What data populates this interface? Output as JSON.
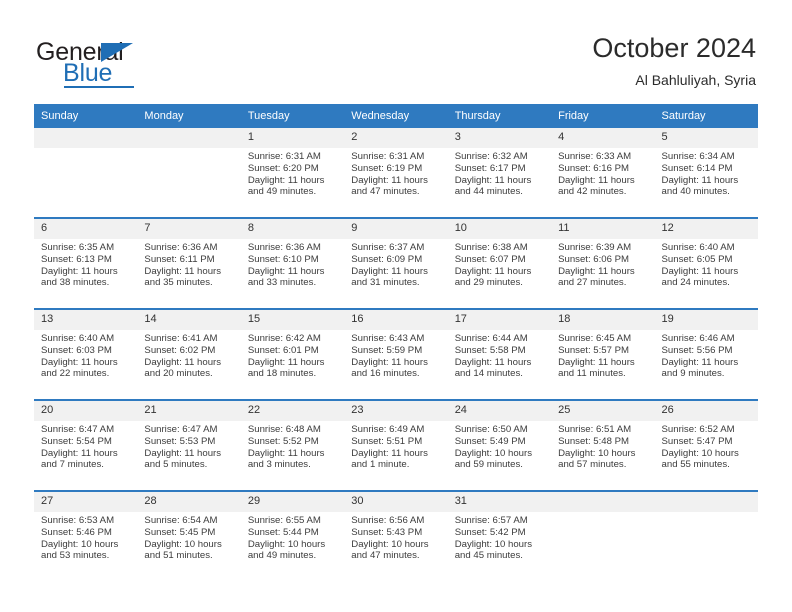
{
  "brand": {
    "name_top": "General",
    "name_bottom": "Blue",
    "accent_color": "#1f6eb5"
  },
  "header": {
    "title": "October 2024",
    "subtitle": "Al Bahluliyah, Syria"
  },
  "theme": {
    "header_blue": "#2f7ac0",
    "daynum_gray": "#f1f1f1",
    "text": "#3c3c3c"
  },
  "calendar": {
    "weekday_headers": [
      "Sunday",
      "Monday",
      "Tuesday",
      "Wednesday",
      "Thursday",
      "Friday",
      "Saturday"
    ],
    "weeks": [
      [
        {
          "day": "",
          "blank": true
        },
        {
          "day": "",
          "blank": true
        },
        {
          "day": "1",
          "sunrise": "Sunrise: 6:31 AM",
          "sunset": "Sunset: 6:20 PM",
          "daylight": "Daylight: 11 hours and 49 minutes."
        },
        {
          "day": "2",
          "sunrise": "Sunrise: 6:31 AM",
          "sunset": "Sunset: 6:19 PM",
          "daylight": "Daylight: 11 hours and 47 minutes."
        },
        {
          "day": "3",
          "sunrise": "Sunrise: 6:32 AM",
          "sunset": "Sunset: 6:17 PM",
          "daylight": "Daylight: 11 hours and 44 minutes."
        },
        {
          "day": "4",
          "sunrise": "Sunrise: 6:33 AM",
          "sunset": "Sunset: 6:16 PM",
          "daylight": "Daylight: 11 hours and 42 minutes."
        },
        {
          "day": "5",
          "sunrise": "Sunrise: 6:34 AM",
          "sunset": "Sunset: 6:14 PM",
          "daylight": "Daylight: 11 hours and 40 minutes."
        }
      ],
      [
        {
          "day": "6",
          "sunrise": "Sunrise: 6:35 AM",
          "sunset": "Sunset: 6:13 PM",
          "daylight": "Daylight: 11 hours and 38 minutes."
        },
        {
          "day": "7",
          "sunrise": "Sunrise: 6:36 AM",
          "sunset": "Sunset: 6:11 PM",
          "daylight": "Daylight: 11 hours and 35 minutes."
        },
        {
          "day": "8",
          "sunrise": "Sunrise: 6:36 AM",
          "sunset": "Sunset: 6:10 PM",
          "daylight": "Daylight: 11 hours and 33 minutes."
        },
        {
          "day": "9",
          "sunrise": "Sunrise: 6:37 AM",
          "sunset": "Sunset: 6:09 PM",
          "daylight": "Daylight: 11 hours and 31 minutes."
        },
        {
          "day": "10",
          "sunrise": "Sunrise: 6:38 AM",
          "sunset": "Sunset: 6:07 PM",
          "daylight": "Daylight: 11 hours and 29 minutes."
        },
        {
          "day": "11",
          "sunrise": "Sunrise: 6:39 AM",
          "sunset": "Sunset: 6:06 PM",
          "daylight": "Daylight: 11 hours and 27 minutes."
        },
        {
          "day": "12",
          "sunrise": "Sunrise: 6:40 AM",
          "sunset": "Sunset: 6:05 PM",
          "daylight": "Daylight: 11 hours and 24 minutes."
        }
      ],
      [
        {
          "day": "13",
          "sunrise": "Sunrise: 6:40 AM",
          "sunset": "Sunset: 6:03 PM",
          "daylight": "Daylight: 11 hours and 22 minutes."
        },
        {
          "day": "14",
          "sunrise": "Sunrise: 6:41 AM",
          "sunset": "Sunset: 6:02 PM",
          "daylight": "Daylight: 11 hours and 20 minutes."
        },
        {
          "day": "15",
          "sunrise": "Sunrise: 6:42 AM",
          "sunset": "Sunset: 6:01 PM",
          "daylight": "Daylight: 11 hours and 18 minutes."
        },
        {
          "day": "16",
          "sunrise": "Sunrise: 6:43 AM",
          "sunset": "Sunset: 5:59 PM",
          "daylight": "Daylight: 11 hours and 16 minutes."
        },
        {
          "day": "17",
          "sunrise": "Sunrise: 6:44 AM",
          "sunset": "Sunset: 5:58 PM",
          "daylight": "Daylight: 11 hours and 14 minutes."
        },
        {
          "day": "18",
          "sunrise": "Sunrise: 6:45 AM",
          "sunset": "Sunset: 5:57 PM",
          "daylight": "Daylight: 11 hours and 11 minutes."
        },
        {
          "day": "19",
          "sunrise": "Sunrise: 6:46 AM",
          "sunset": "Sunset: 5:56 PM",
          "daylight": "Daylight: 11 hours and 9 minutes."
        }
      ],
      [
        {
          "day": "20",
          "sunrise": "Sunrise: 6:47 AM",
          "sunset": "Sunset: 5:54 PM",
          "daylight": "Daylight: 11 hours and 7 minutes."
        },
        {
          "day": "21",
          "sunrise": "Sunrise: 6:47 AM",
          "sunset": "Sunset: 5:53 PM",
          "daylight": "Daylight: 11 hours and 5 minutes."
        },
        {
          "day": "22",
          "sunrise": "Sunrise: 6:48 AM",
          "sunset": "Sunset: 5:52 PM",
          "daylight": "Daylight: 11 hours and 3 minutes."
        },
        {
          "day": "23",
          "sunrise": "Sunrise: 6:49 AM",
          "sunset": "Sunset: 5:51 PM",
          "daylight": "Daylight: 11 hours and 1 minute."
        },
        {
          "day": "24",
          "sunrise": "Sunrise: 6:50 AM",
          "sunset": "Sunset: 5:49 PM",
          "daylight": "Daylight: 10 hours and 59 minutes."
        },
        {
          "day": "25",
          "sunrise": "Sunrise: 6:51 AM",
          "sunset": "Sunset: 5:48 PM",
          "daylight": "Daylight: 10 hours and 57 minutes."
        },
        {
          "day": "26",
          "sunrise": "Sunrise: 6:52 AM",
          "sunset": "Sunset: 5:47 PM",
          "daylight": "Daylight: 10 hours and 55 minutes."
        }
      ],
      [
        {
          "day": "27",
          "sunrise": "Sunrise: 6:53 AM",
          "sunset": "Sunset: 5:46 PM",
          "daylight": "Daylight: 10 hours and 53 minutes."
        },
        {
          "day": "28",
          "sunrise": "Sunrise: 6:54 AM",
          "sunset": "Sunset: 5:45 PM",
          "daylight": "Daylight: 10 hours and 51 minutes."
        },
        {
          "day": "29",
          "sunrise": "Sunrise: 6:55 AM",
          "sunset": "Sunset: 5:44 PM",
          "daylight": "Daylight: 10 hours and 49 minutes."
        },
        {
          "day": "30",
          "sunrise": "Sunrise: 6:56 AM",
          "sunset": "Sunset: 5:43 PM",
          "daylight": "Daylight: 10 hours and 47 minutes."
        },
        {
          "day": "31",
          "sunrise": "Sunrise: 6:57 AM",
          "sunset": "Sunset: 5:42 PM",
          "daylight": "Daylight: 10 hours and 45 minutes."
        },
        {
          "day": "",
          "blank": true
        },
        {
          "day": "",
          "blank": true
        }
      ]
    ]
  }
}
